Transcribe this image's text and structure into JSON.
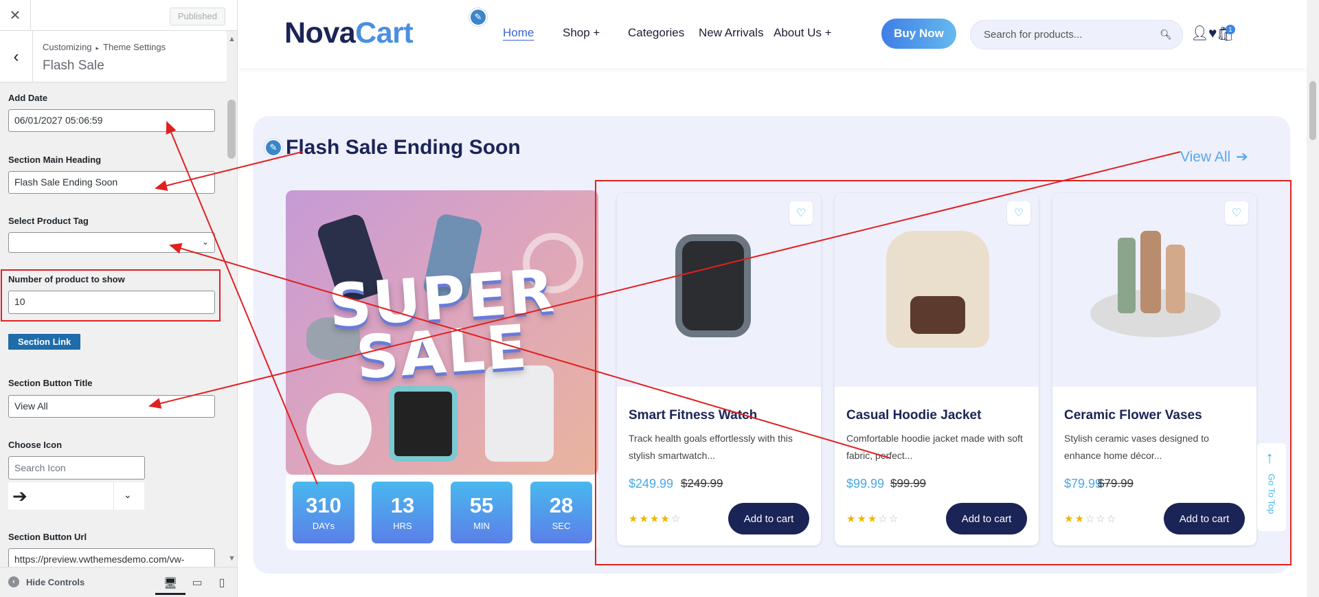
{
  "customizer": {
    "close_icon": "close-icon",
    "published_label": "Published",
    "breadcrumb_root": "Customizing",
    "breadcrumb_sep": "▸",
    "breadcrumb_parent": "Theme Settings",
    "section_title": "Flash Sale",
    "fields": {
      "add_date_label": "Add Date",
      "add_date_value": "06/01/2027 05:06:59",
      "main_heading_label": "Section Main Heading",
      "main_heading_value": "Flash Sale Ending Soon",
      "product_tag_label": "Select Product Tag",
      "product_tag_value": "",
      "num_products_label": "Number of product to show",
      "num_products_value": "10",
      "section_link_label": "Section Link",
      "button_title_label": "Section Button Title",
      "button_title_value": "View All",
      "choose_icon_label": "Choose Icon",
      "icon_search_placeholder": "Search Icon",
      "button_url_label": "Section Button Url",
      "button_url_value": "https://preview.vwthemesdemo.com/vw-"
    },
    "footer": {
      "hide_controls_label": "Hide Controls",
      "devices": [
        "desktop",
        "tablet",
        "mobile"
      ]
    }
  },
  "site": {
    "logo_part1": "Nova",
    "logo_part2": "Cart",
    "nav": {
      "home": "Home",
      "shop": "Shop +",
      "categories": "Categories",
      "new_arrivals": "New Arrivals",
      "about": "About Us +"
    },
    "buy_now": "Buy Now",
    "search_placeholder": "Search for products...",
    "cart_count": "1",
    "colors": {
      "accent": "#4c8fe0",
      "navy": "#1b2456",
      "sky": "#49b8ef"
    }
  },
  "flash_sale": {
    "heading": "Flash Sale Ending Soon",
    "view_all": "View All",
    "promo_line1": "SUPER",
    "promo_line2": "SALE",
    "countdown": [
      {
        "value": "310",
        "unit": "DAYs"
      },
      {
        "value": "13",
        "unit": "HRS"
      },
      {
        "value": "55",
        "unit": "MIN"
      },
      {
        "value": "28",
        "unit": "SEC"
      }
    ],
    "products": [
      {
        "name": "Smart Fitness Watch",
        "desc": "Track health goals effortlessly with this stylish smartwatch...",
        "price": "$249.99",
        "old_price": "$249.99",
        "rating": 4.5,
        "cta": "Add to cart"
      },
      {
        "name": "Casual Hoodie Jacket",
        "desc": "Comfortable hoodie jacket made with soft fabric, perfect...",
        "price": "$99.99",
        "old_price": "$99.99",
        "rating": 3,
        "cta": "Add to cart"
      },
      {
        "name": "Ceramic Flower Vases",
        "desc": "Stylish ceramic vases designed to enhance home décor...",
        "price": "$79.99",
        "old_price": "$79.99",
        "rating": 2,
        "cta": "Add to cart"
      }
    ],
    "go_top": "Go To Top"
  }
}
